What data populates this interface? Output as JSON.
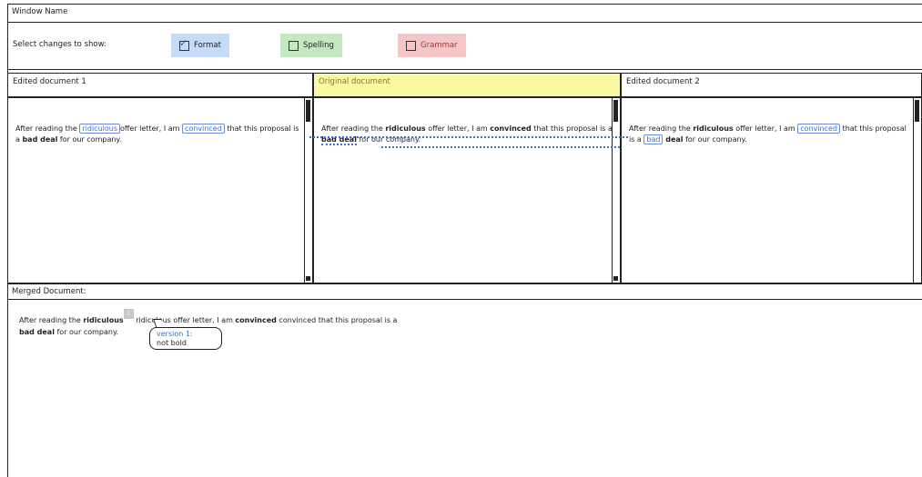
{
  "window": {
    "title": "Window Name"
  },
  "toolbar": {
    "label": "Select changes to show:",
    "filters": [
      {
        "label": "Format",
        "checked": true,
        "color": "#c6dbf7"
      },
      {
        "label": "Spelling",
        "checked": false,
        "color": "#c5e8c3"
      },
      {
        "label": "Grammar",
        "checked": false,
        "color": "#f5c6c6"
      }
    ]
  },
  "panes": {
    "edited1": {
      "title": "Edited document 1",
      "text": [
        "After reading the ",
        "ridiculous",
        "offer letter, I am ",
        "convinced",
        " that this proposal is a ",
        "bad deal",
        " for our company."
      ]
    },
    "original": {
      "title": "Original document",
      "header_color": "#fbf8a4",
      "text": [
        "After reading the ",
        "ridiculous",
        " offer letter, I am ",
        "convinced",
        " that this proposal is a ",
        "bad deal",
        " for our company."
      ]
    },
    "edited2": {
      "title": "Edited document 2",
      "text": [
        "After reading the ",
        "ridiculous",
        " offer letter, I am ",
        "convinced",
        " that this proposal is a ",
        "bad",
        " deal",
        " for our company."
      ]
    }
  },
  "merged": {
    "title": "Merged Document:",
    "text": [
      "After reading the ",
      "ridiculous",
      "ridiculous offer letter, I am ",
      "convinced",
      " convinced that this proposal is a ",
      "bad deal",
      " for our company."
    ],
    "marker": "1",
    "bubble": {
      "version": "version 1:",
      "note": "not bold"
    }
  }
}
